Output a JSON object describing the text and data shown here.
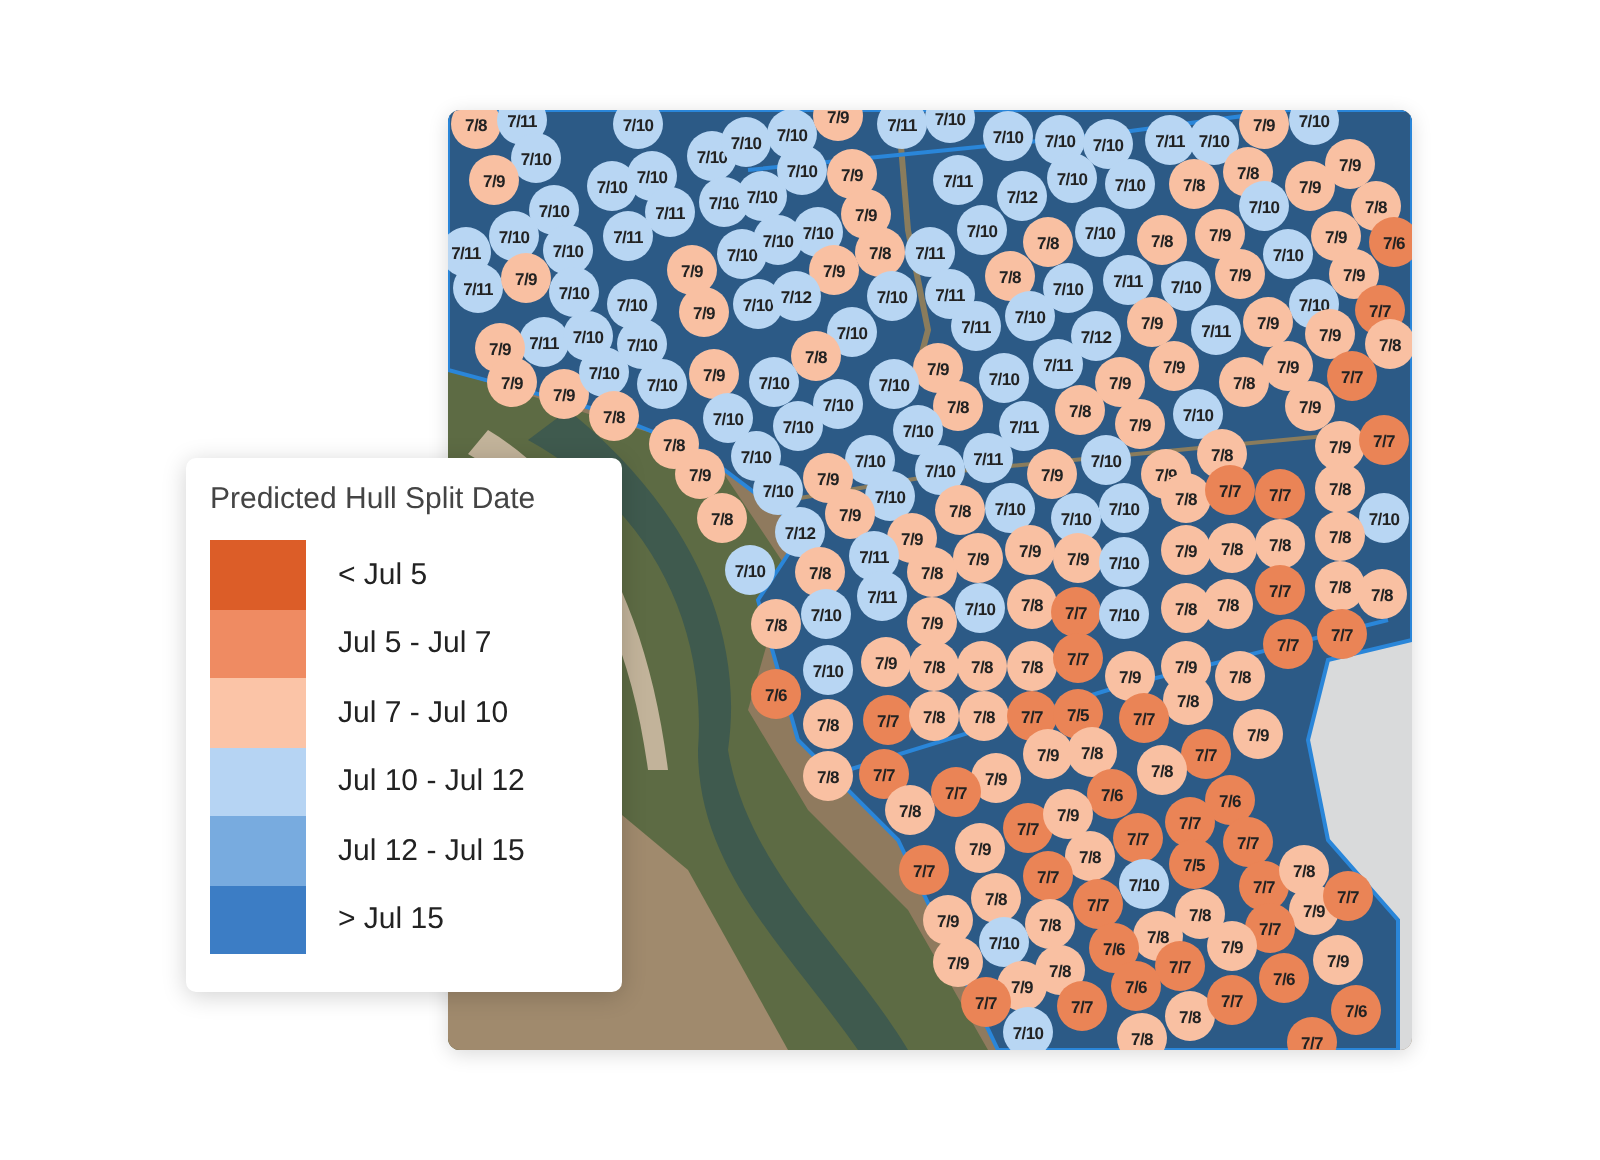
{
  "legend": {
    "title": "Predicted Hull Split Date",
    "items": [
      {
        "label": "< Jul 5",
        "color": "#dc5d28"
      },
      {
        "label": "Jul 5 - Jul 7",
        "color": "#ef8b62"
      },
      {
        "label": "Jul 7 - Jul 10",
        "color": "#fbc4a7"
      },
      {
        "label": "Jul 10 - Jul 12",
        "color": "#b6d4f3"
      },
      {
        "label": "Jul 12 - Jul 15",
        "color": "#78abdf"
      },
      {
        "label": "> Jul 15",
        "color": "#3c7dc5"
      }
    ]
  },
  "map": {
    "kind": "picture",
    "markers": [
      {
        "label": "7/8",
        "color": "#f9c0a2"
      },
      {
        "label": "7/11",
        "color": "#b8d6f3"
      },
      {
        "label": "7/10",
        "color": "#b8d6f3"
      },
      {
        "label": "7/10",
        "color": "#b8d6f3"
      },
      {
        "label": "7/9",
        "color": "#f9c0a2"
      },
      {
        "label": "7/11",
        "color": "#b8d6f3"
      },
      {
        "label": "7/10",
        "color": "#b8d6f3"
      },
      {
        "label": "7/9",
        "color": "#f9c0a2"
      },
      {
        "label": "7/10",
        "color": "#b8d6f3"
      },
      {
        "label": "7/10",
        "color": "#b8d6f3"
      },
      {
        "label": "7/10",
        "color": "#b8d6f3"
      },
      {
        "label": "7/10",
        "color": "#b8d6f3"
      },
      {
        "label": "7/10",
        "color": "#b8d6f3"
      },
      {
        "label": "7/10",
        "color": "#b8d6f3"
      },
      {
        "label": "7/10",
        "color": "#b8d6f3"
      },
      {
        "label": "7/11",
        "color": "#b8d6f3"
      },
      {
        "label": "7/10",
        "color": "#b8d6f3"
      },
      {
        "label": "7/9",
        "color": "#f9c0a2"
      },
      {
        "label": "7/10",
        "color": "#b8d6f3"
      },
      {
        "label": "7/10",
        "color": "#b8d6f3"
      },
      {
        "label": "7/10",
        "color": "#b8d6f3"
      },
      {
        "label": "7/9",
        "color": "#f9c0a2"
      },
      {
        "label": "7/11",
        "color": "#b8d6f3"
      },
      {
        "label": "7/10",
        "color": "#b8d6f3"
      },
      {
        "label": "7/10",
        "color": "#b8d6f3"
      },
      {
        "label": "7/8",
        "color": "#f9c0a2"
      },
      {
        "label": "7/8",
        "color": "#f9c0a2"
      },
      {
        "label": "7/9",
        "color": "#f9c0a2"
      },
      {
        "label": "7/9",
        "color": "#f9c0a2"
      },
      {
        "label": "7/10",
        "color": "#b8d6f3"
      },
      {
        "label": "7/11",
        "color": "#b8d6f3"
      },
      {
        "label": "7/10",
        "color": "#b8d6f3"
      },
      {
        "label": "7/10",
        "color": "#b8d6f3"
      },
      {
        "label": "7/12",
        "color": "#b8d6f3"
      },
      {
        "label": "7/10",
        "color": "#b8d6f3"
      },
      {
        "label": "7/8",
        "color": "#f9c0a2"
      },
      {
        "label": "7/10",
        "color": "#b8d6f3"
      },
      {
        "label": "7/11",
        "color": "#b8d6f3"
      },
      {
        "label": "7/10",
        "color": "#b8d6f3"
      },
      {
        "label": "7/9",
        "color": "#f9c0a2"
      },
      {
        "label": "7/10",
        "color": "#b8d6f3"
      },
      {
        "label": "7/10",
        "color": "#b8d6f3"
      },
      {
        "label": "7/9",
        "color": "#f9c0a2"
      },
      {
        "label": "7/9",
        "color": "#f9c0a2"
      },
      {
        "label": "7/11",
        "color": "#b8d6f3"
      },
      {
        "label": "7/10",
        "color": "#b8d6f3"
      },
      {
        "label": "7/10",
        "color": "#b8d6f3"
      },
      {
        "label": "7/10",
        "color": "#b8d6f3"
      },
      {
        "label": "7/8",
        "color": "#f9c0a2"
      },
      {
        "label": "7/11",
        "color": "#b8d6f3"
      },
      {
        "label": "7/8",
        "color": "#f9c0a2"
      },
      {
        "label": "7/8",
        "color": "#f9c0a2"
      },
      {
        "label": "7/10",
        "color": "#b8d6f3"
      },
      {
        "label": "7/6",
        "color": "#ea8456"
      },
      {
        "label": "7/11",
        "color": "#b8d6f3"
      },
      {
        "label": "7/9",
        "color": "#f9c0a2"
      },
      {
        "label": "7/9",
        "color": "#f9c0a2"
      },
      {
        "label": "7/9",
        "color": "#f9c0a2"
      },
      {
        "label": "7/8",
        "color": "#f9c0a2"
      },
      {
        "label": "7/10",
        "color": "#b8d6f3"
      },
      {
        "label": "7/11",
        "color": "#b8d6f3"
      },
      {
        "label": "7/10",
        "color": "#b8d6f3"
      },
      {
        "label": "7/9",
        "color": "#f9c0a2"
      },
      {
        "label": "7/9",
        "color": "#f9c0a2"
      },
      {
        "label": "7/10",
        "color": "#b8d6f3"
      },
      {
        "label": "7/10",
        "color": "#b8d6f3"
      },
      {
        "label": "7/9",
        "color": "#f9c0a2"
      },
      {
        "label": "7/10",
        "color": "#b8d6f3"
      },
      {
        "label": "7/12",
        "color": "#b8d6f3"
      },
      {
        "label": "7/10",
        "color": "#b8d6f3"
      },
      {
        "label": "7/11",
        "color": "#b8d6f3"
      },
      {
        "label": "7/10",
        "color": "#b8d6f3"
      },
      {
        "label": "7/10",
        "color": "#b8d6f3"
      },
      {
        "label": "7/7",
        "color": "#ea8456"
      },
      {
        "label": "7/11",
        "color": "#b8d6f3"
      },
      {
        "label": "7/10",
        "color": "#b8d6f3"
      },
      {
        "label": "7/10",
        "color": "#b8d6f3"
      },
      {
        "label": "7/11",
        "color": "#b8d6f3"
      },
      {
        "label": "7/12",
        "color": "#b8d6f3"
      },
      {
        "label": "7/9",
        "color": "#f9c0a2"
      },
      {
        "label": "7/11",
        "color": "#b8d6f3"
      },
      {
        "label": "7/9",
        "color": "#f9c0a2"
      },
      {
        "label": "7/9",
        "color": "#f9c0a2"
      },
      {
        "label": "7/9",
        "color": "#f9c0a2"
      },
      {
        "label": "7/10",
        "color": "#b8d6f3"
      },
      {
        "label": "7/8",
        "color": "#f9c0a2"
      },
      {
        "label": "7/9",
        "color": "#f9c0a2"
      },
      {
        "label": "7/11",
        "color": "#b8d6f3"
      },
      {
        "label": "7/9",
        "color": "#f9c0a2"
      },
      {
        "label": "7/9",
        "color": "#f9c0a2"
      },
      {
        "label": "7/8",
        "color": "#f9c0a2"
      },
      {
        "label": "7/9",
        "color": "#f9c0a2"
      },
      {
        "label": "7/9",
        "color": "#f9c0a2"
      },
      {
        "label": "7/10",
        "color": "#b8d6f3"
      },
      {
        "label": "7/10",
        "color": "#b8d6f3"
      },
      {
        "label": "7/9",
        "color": "#f9c0a2"
      },
      {
        "label": "7/10",
        "color": "#b8d6f3"
      },
      {
        "label": "7/10",
        "color": "#b8d6f3"
      },
      {
        "label": "7/10",
        "color": "#b8d6f3"
      },
      {
        "label": "7/9",
        "color": "#f9c0a2"
      },
      {
        "label": "7/8",
        "color": "#f9c0a2"
      },
      {
        "label": "7/7",
        "color": "#ea8456"
      },
      {
        "label": "7/8",
        "color": "#f9c0a2"
      },
      {
        "label": "7/10",
        "color": "#b8d6f3"
      },
      {
        "label": "7/10",
        "color": "#b8d6f3"
      },
      {
        "label": "7/8",
        "color": "#f9c0a2"
      },
      {
        "label": "7/8",
        "color": "#f9c0a2"
      },
      {
        "label": "7/10",
        "color": "#b8d6f3"
      },
      {
        "label": "7/9",
        "color": "#f9c0a2"
      },
      {
        "label": "7/8",
        "color": "#f9c0a2"
      },
      {
        "label": "7/10",
        "color": "#b8d6f3"
      },
      {
        "label": "7/10",
        "color": "#b8d6f3"
      },
      {
        "label": "7/11",
        "color": "#b8d6f3"
      },
      {
        "label": "7/9",
        "color": "#f9c0a2"
      },
      {
        "label": "7/9",
        "color": "#f9c0a2"
      },
      {
        "label": "7/7",
        "color": "#ea8456"
      },
      {
        "label": "7/10",
        "color": "#b8d6f3"
      },
      {
        "label": "7/10",
        "color": "#b8d6f3"
      },
      {
        "label": "7/10",
        "color": "#b8d6f3"
      },
      {
        "label": "7/11",
        "color": "#b8d6f3"
      },
      {
        "label": "7/10",
        "color": "#b8d6f3"
      },
      {
        "label": "7/8",
        "color": "#f9c0a2"
      },
      {
        "label": "7/9",
        "color": "#f9c0a2"
      },
      {
        "label": "7/10",
        "color": "#b8d6f3"
      },
      {
        "label": "7/9",
        "color": "#f9c0a2"
      },
      {
        "label": "7/10",
        "color": "#b8d6f3"
      },
      {
        "label": "7/9",
        "color": "#f9c0a2"
      },
      {
        "label": "7/9",
        "color": "#f9c0a2"
      },
      {
        "label": "7/8",
        "color": "#f9c0a2"
      },
      {
        "label": "7/7",
        "color": "#ea8456"
      },
      {
        "label": "7/7",
        "color": "#ea8456"
      },
      {
        "label": "7/8",
        "color": "#f9c0a2"
      },
      {
        "label": "7/8",
        "color": "#f9c0a2"
      },
      {
        "label": "7/9",
        "color": "#f9c0a2"
      },
      {
        "label": "7/8",
        "color": "#f9c0a2"
      },
      {
        "label": "7/10",
        "color": "#b8d6f3"
      },
      {
        "label": "7/10",
        "color": "#b8d6f3"
      },
      {
        "label": "7/10",
        "color": "#b8d6f3"
      },
      {
        "label": "7/10",
        "color": "#b8d6f3"
      },
      {
        "label": "7/12",
        "color": "#b8d6f3"
      },
      {
        "label": "7/9",
        "color": "#f9c0a2"
      },
      {
        "label": "7/9",
        "color": "#f9c0a2"
      },
      {
        "label": "7/9",
        "color": "#f9c0a2"
      },
      {
        "label": "7/8",
        "color": "#f9c0a2"
      },
      {
        "label": "7/8",
        "color": "#f9c0a2"
      },
      {
        "label": "7/8",
        "color": "#f9c0a2"
      },
      {
        "label": "7/10",
        "color": "#b8d6f3"
      },
      {
        "label": "7/8",
        "color": "#f9c0a2"
      },
      {
        "label": "7/11",
        "color": "#b8d6f3"
      },
      {
        "label": "7/8",
        "color": "#f9c0a2"
      },
      {
        "label": "7/9",
        "color": "#f9c0a2"
      },
      {
        "label": "7/9",
        "color": "#f9c0a2"
      },
      {
        "label": "7/10",
        "color": "#b8d6f3"
      },
      {
        "label": "7/11",
        "color": "#b8d6f3"
      },
      {
        "label": "7/7",
        "color": "#ea8456"
      },
      {
        "label": "7/8",
        "color": "#f9c0a2"
      },
      {
        "label": "7/8",
        "color": "#f9c0a2"
      },
      {
        "label": "7/8",
        "color": "#f9c0a2"
      },
      {
        "label": "7/10",
        "color": "#b8d6f3"
      },
      {
        "label": "7/9",
        "color": "#f9c0a2"
      },
      {
        "label": "7/10",
        "color": "#b8d6f3"
      },
      {
        "label": "7/8",
        "color": "#f9c0a2"
      },
      {
        "label": "7/7",
        "color": "#ea8456"
      },
      {
        "label": "7/10",
        "color": "#b8d6f3"
      },
      {
        "label": "7/8",
        "color": "#f9c0a2"
      },
      {
        "label": "7/8",
        "color": "#f9c0a2"
      },
      {
        "label": "7/7",
        "color": "#ea8456"
      },
      {
        "label": "7/7",
        "color": "#ea8456"
      },
      {
        "label": "7/10",
        "color": "#b8d6f3"
      },
      {
        "label": "7/9",
        "color": "#f9c0a2"
      },
      {
        "label": "7/8",
        "color": "#f9c0a2"
      },
      {
        "label": "7/8",
        "color": "#f9c0a2"
      },
      {
        "label": "7/8",
        "color": "#f9c0a2"
      },
      {
        "label": "7/7",
        "color": "#ea8456"
      },
      {
        "label": "7/9",
        "color": "#f9c0a2"
      },
      {
        "label": "7/9",
        "color": "#f9c0a2"
      },
      {
        "label": "7/8",
        "color": "#f9c0a2"
      },
      {
        "label": "7/6",
        "color": "#ea8456"
      },
      {
        "label": "7/8",
        "color": "#f9c0a2"
      },
      {
        "label": "7/8",
        "color": "#f9c0a2"
      },
      {
        "label": "7/7",
        "color": "#ea8456"
      },
      {
        "label": "7/8",
        "color": "#f9c0a2"
      },
      {
        "label": "7/8",
        "color": "#f9c0a2"
      },
      {
        "label": "7/7",
        "color": "#ea8456"
      },
      {
        "label": "7/5",
        "color": "#ea8456"
      },
      {
        "label": "7/7",
        "color": "#ea8456"
      },
      {
        "label": "7/9",
        "color": "#f9c0a2"
      },
      {
        "label": "7/8",
        "color": "#f9c0a2"
      },
      {
        "label": "7/7",
        "color": "#ea8456"
      },
      {
        "label": "7/9",
        "color": "#f9c0a2"
      },
      {
        "label": "7/8",
        "color": "#f9c0a2"
      },
      {
        "label": "7/7",
        "color": "#ea8456"
      },
      {
        "label": "7/9",
        "color": "#f9c0a2"
      },
      {
        "label": "7/8",
        "color": "#f9c0a2"
      },
      {
        "label": "7/8",
        "color": "#f9c0a2"
      },
      {
        "label": "7/7",
        "color": "#ea8456"
      },
      {
        "label": "7/6",
        "color": "#ea8456"
      },
      {
        "label": "7/6",
        "color": "#ea8456"
      },
      {
        "label": "7/7",
        "color": "#ea8456"
      },
      {
        "label": "7/9",
        "color": "#f9c0a2"
      },
      {
        "label": "7/7",
        "color": "#ea8456"
      },
      {
        "label": "7/9",
        "color": "#f9c0a2"
      },
      {
        "label": "7/8",
        "color": "#f9c0a2"
      },
      {
        "label": "7/7",
        "color": "#ea8456"
      },
      {
        "label": "7/7",
        "color": "#ea8456"
      },
      {
        "label": "7/7",
        "color": "#ea8456"
      },
      {
        "label": "7/7",
        "color": "#ea8456"
      },
      {
        "label": "7/10",
        "color": "#b8d6f3"
      },
      {
        "label": "7/5",
        "color": "#ea8456"
      },
      {
        "label": "7/7",
        "color": "#ea8456"
      },
      {
        "label": "7/8",
        "color": "#f9c0a2"
      },
      {
        "label": "7/8",
        "color": "#f9c0a2"
      },
      {
        "label": "7/7",
        "color": "#ea8456"
      },
      {
        "label": "7/8",
        "color": "#f9c0a2"
      },
      {
        "label": "7/9",
        "color": "#f9c0a2"
      },
      {
        "label": "7/7",
        "color": "#ea8456"
      },
      {
        "label": "7/9",
        "color": "#f9c0a2"
      },
      {
        "label": "7/8",
        "color": "#f9c0a2"
      },
      {
        "label": "7/8",
        "color": "#f9c0a2"
      },
      {
        "label": "7/7",
        "color": "#ea8456"
      },
      {
        "label": "7/9",
        "color": "#f9c0a2"
      },
      {
        "label": "7/10",
        "color": "#b8d6f3"
      },
      {
        "label": "7/6",
        "color": "#ea8456"
      },
      {
        "label": "7/7",
        "color": "#ea8456"
      },
      {
        "label": "7/9",
        "color": "#f9c0a2"
      },
      {
        "label": "7/9",
        "color": "#f9c0a2"
      },
      {
        "label": "7/9",
        "color": "#f9c0a2"
      },
      {
        "label": "7/8",
        "color": "#f9c0a2"
      },
      {
        "label": "7/6",
        "color": "#ea8456"
      },
      {
        "label": "7/6",
        "color": "#ea8456"
      },
      {
        "label": "7/7",
        "color": "#ea8456"
      },
      {
        "label": "7/7",
        "color": "#ea8456"
      },
      {
        "label": "7/8",
        "color": "#f9c0a2"
      },
      {
        "label": "7/7",
        "color": "#ea8456"
      },
      {
        "label": "7/6",
        "color": "#ea8456"
      },
      {
        "label": "7/10",
        "color": "#b8d6f3"
      },
      {
        "label": "7/8",
        "color": "#f9c0a2"
      },
      {
        "label": "7/7",
        "color": "#ea8456"
      }
    ]
  }
}
